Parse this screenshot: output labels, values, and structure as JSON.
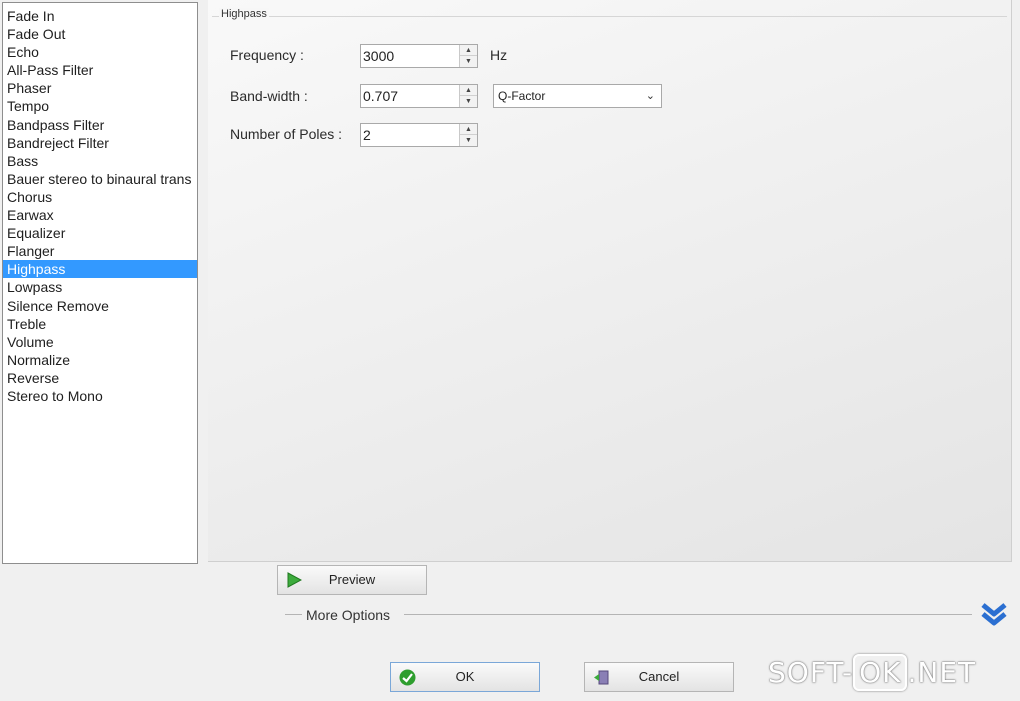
{
  "effects": [
    "Fade In",
    "Fade Out",
    "Echo",
    "All-Pass Filter",
    "Phaser",
    "Tempo",
    "Bandpass Filter",
    "Bandreject Filter",
    "Bass",
    "Bauer stereo to binaural trans",
    "Chorus",
    "Earwax",
    "Equalizer",
    "Flanger",
    "Highpass",
    "Lowpass",
    "Silence Remove",
    "Treble",
    "Volume",
    "Normalize",
    "Reverse",
    "Stereo to Mono"
  ],
  "selected_effect": "Highpass",
  "panel": {
    "group_title": "Highpass",
    "frequency_label": "Frequency :",
    "frequency_value": "3000",
    "frequency_unit": "Hz",
    "bandwidth_label": "Band-width :",
    "bandwidth_value": "0.707",
    "bandwidth_type": "Q-Factor",
    "poles_label": "Number of Poles :",
    "poles_value": "2"
  },
  "preview_label": "Preview",
  "more_options_label": "More Options",
  "ok_label": "OK",
  "cancel_label": "Cancel",
  "watermark": {
    "left": "SOFT-",
    "ok": "OK",
    "right": ".NET"
  },
  "colors": {
    "selection": "#3399ff",
    "ok_icon": "#2e9e2e",
    "expand_icon": "#2b6fd1",
    "preview_icon": "#3cab3c"
  }
}
